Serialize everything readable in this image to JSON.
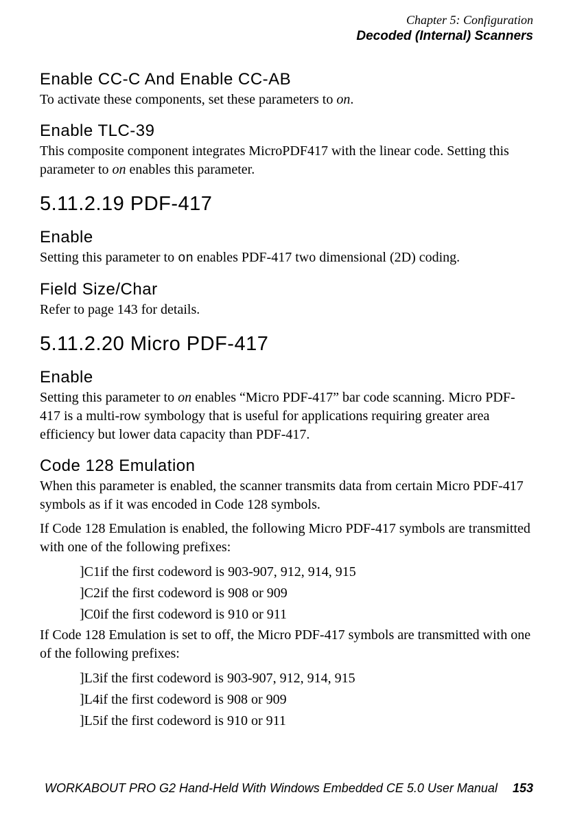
{
  "header": {
    "chapter": "Chapter 5: Configuration",
    "section": "Decoded (Internal) Scanners"
  },
  "s1": {
    "h": "Enable CC-C And Enable CC-AB",
    "p_a": "To activate these components, set these parameters to ",
    "p_em": "on",
    "p_b": "."
  },
  "s2": {
    "h": "Enable TLC-39",
    "p_a": "This composite component integrates MicroPDF417 with the linear code. Setting this parameter to ",
    "p_em": "on",
    "p_b": " enables this parameter."
  },
  "s3": {
    "h": "5.11.2.19  PDF-417",
    "sub1": "Enable",
    "p1_a": "Setting this parameter to ",
    "p1_mono": "on",
    "p1_b": " enables PDF-417 two dimensional (2D) coding.",
    "sub2": "Field Size/Char",
    "p2": "Refer to page 143 for details."
  },
  "s4": {
    "h": "5.11.2.20  Micro PDF-417",
    "sub1": "Enable",
    "p1_a": "Setting this parameter to ",
    "p1_em": "on",
    "p1_b": " enables “Micro PDF-417” bar code scanning. Micro PDF-417 is a multi-row symbology that is useful for applications requiring greater area efficiency but lower data capacity than PDF-417.",
    "sub2": "Code 128 Emulation",
    "p2": "When this parameter is enabled, the scanner transmits data from certain Micro PDF-417 symbols as if it was encoded in Code 128 symbols.",
    "p3": "If Code 128 Emulation is enabled, the following Micro PDF-417 symbols are transmitted with one of the following prefixes:",
    "l1": "]C1if the first codeword is 903-907, 912, 914, 915",
    "l2": "]C2if the first codeword is 908 or 909",
    "l3": "]C0if the first codeword is 910 or 911",
    "p4": "If Code 128 Emulation is set to off, the Micro PDF-417 symbols are transmitted with one of the following prefixes:",
    "l4": "]L3if the first codeword is 903-907, 912, 914, 915",
    "l5": "]L4if the first codeword is 908 or 909",
    "l6": "]L5if the first codeword is 910 or 911"
  },
  "footer": {
    "text": "WORKABOUT PRO G2 Hand-Held With Windows Embedded CE 5.0 User Manual",
    "page": "153"
  }
}
